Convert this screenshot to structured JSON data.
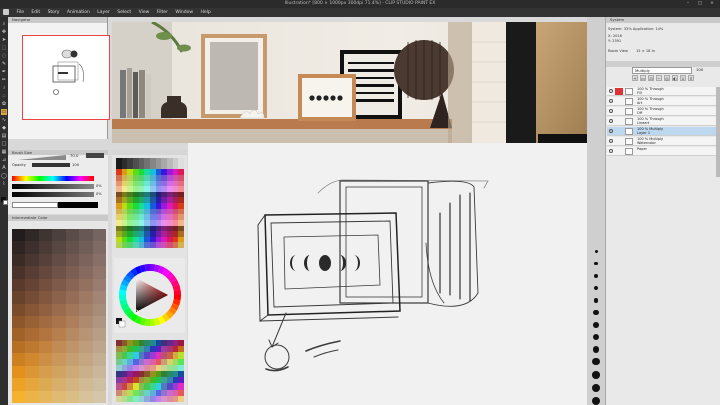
{
  "app": {
    "title": "Illustration* [800 × 1000px 300dpi 71.4%] - CLIP STUDIO PAINT EX",
    "menu": [
      "File",
      "Edit",
      "Story",
      "Animation",
      "Layer",
      "Select",
      "View",
      "Filter",
      "Window",
      "Help"
    ]
  },
  "tabs": {
    "navigator": "Navigator",
    "canvas_tab": "Illustration*"
  },
  "brush": {
    "label": "Brush Size",
    "size": "70.0",
    "opacity_label": "Opacity",
    "opacity": "100"
  },
  "color_sliders": {
    "r": "0%",
    "g": "0%"
  },
  "color_set": {
    "label": "Intermediate Color"
  },
  "right_panel": {
    "system_label": "System",
    "system_info": "System: 33% Application: 14%",
    "coord_x": "X: 2016",
    "coord_y": "Y: 2391",
    "room_label": "Room View",
    "room_value": "15 × 18 in",
    "blend_mode": "Multiply",
    "opacity": "100"
  },
  "layers": [
    {
      "name": "100 % Through",
      "sub": "Fill",
      "selected": false,
      "red": true
    },
    {
      "name": "100 % Through",
      "sub": "Art",
      "selected": false,
      "red": false
    },
    {
      "name": "100 % Through",
      "sub": "Off",
      "selected": false,
      "red": false
    },
    {
      "name": "100 % Through",
      "sub": "Lineart",
      "selected": false,
      "red": false
    },
    {
      "name": "100 % Multiply",
      "sub": "Layer 1",
      "selected": true,
      "red": false
    },
    {
      "name": "100 % Multiply",
      "sub": "Watercolor",
      "selected": false,
      "red": false
    },
    {
      "name": "Paper",
      "sub": "",
      "selected": false,
      "red": false
    }
  ],
  "colors": {
    "accent_red": "#e03434",
    "selection": "#bcd7ee",
    "frame_wood": "#b97a4e"
  }
}
